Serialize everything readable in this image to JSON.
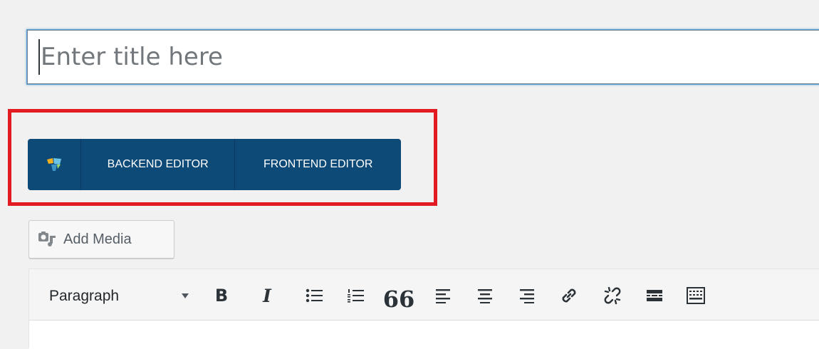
{
  "title": {
    "placeholder": "Enter title here",
    "value": ""
  },
  "vc_bar": {
    "logo_icon": "visual-composer-logo-icon",
    "backend_label": "BACKEND EDITOR",
    "frontend_label": "FRONTEND EDITOR",
    "background": "#0e4a78",
    "highlight_color": "#e21b23"
  },
  "media": {
    "add_media_label": "Add Media",
    "icon": "add-media-icon"
  },
  "toolbar": {
    "format_value": "Paragraph",
    "tools": [
      {
        "icon": "bold-icon",
        "glyph": "B"
      },
      {
        "icon": "italic-icon",
        "glyph": "I"
      },
      {
        "icon": "bulleted-list-icon"
      },
      {
        "icon": "numbered-list-icon"
      },
      {
        "icon": "blockquote-icon",
        "glyph": "66"
      },
      {
        "icon": "align-left-icon"
      },
      {
        "icon": "align-center-icon"
      },
      {
        "icon": "align-right-icon"
      },
      {
        "icon": "insert-link-icon"
      },
      {
        "icon": "remove-link-icon"
      },
      {
        "icon": "read-more-icon"
      },
      {
        "icon": "toolbar-toggle-icon"
      }
    ]
  }
}
